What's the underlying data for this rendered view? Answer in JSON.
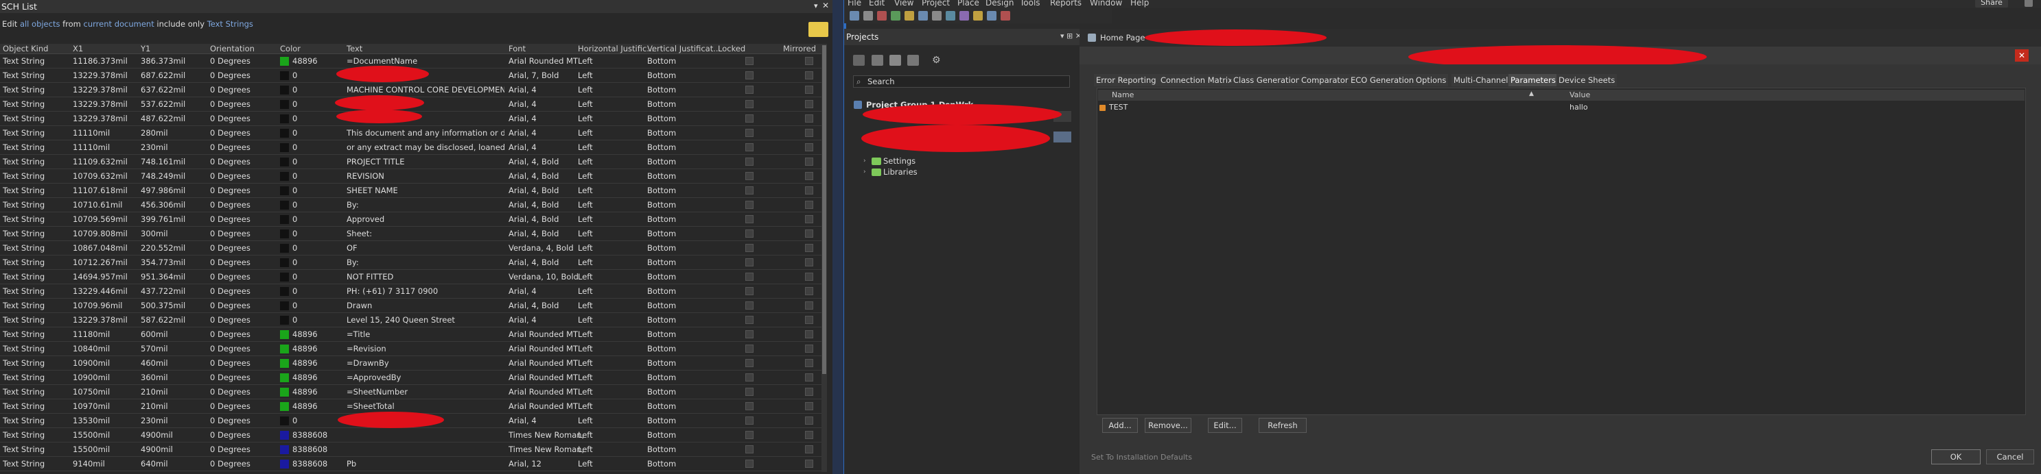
{
  "sch_list": {
    "title": "SCH List",
    "filter": {
      "p1": "Edit ",
      "p2": "all objects",
      "p3": " from ",
      "p4": "current document",
      "p5": " include only ",
      "p6": "Text Strings"
    },
    "columns": [
      "Object Kind",
      "X1",
      "Y1",
      "Orientation",
      "Color",
      "Text",
      "Font",
      "Horizontal Justific...",
      "Vertical Justificat...",
      "Locked",
      "Mirrored"
    ],
    "rows": [
      [
        "Text String",
        "11186.373mil",
        "386.373mil",
        "0 Degrees",
        "48896",
        "=DocumentName",
        "Arial Rounded MT",
        "Left",
        "Bottom",
        "green"
      ],
      [
        "Text String",
        "13229.378mil",
        "687.622mil",
        "0 Degrees",
        "0",
        "",
        "Arial, 7, Bold",
        "Left",
        "Bottom",
        "black"
      ],
      [
        "Text String",
        "13229.378mil",
        "637.622mil",
        "0 Degrees",
        "0",
        "MACHINE CONTROL CORE DEVELOPMENT",
        "Arial, 4",
        "Left",
        "Bottom",
        "black"
      ],
      [
        "Text String",
        "13229.378mil",
        "537.622mil",
        "0 Degrees",
        "0",
        "",
        "Arial, 4",
        "Left",
        "Bottom",
        "black"
      ],
      [
        "Text String",
        "13229.378mil",
        "487.622mil",
        "0 Degrees",
        "0",
        "",
        "Arial, 4",
        "Left",
        "Bottom",
        "black"
      ],
      [
        "Text String",
        "11110mil",
        "280mil",
        "0 Degrees",
        "0",
        "This document and any information or descri",
        "Arial, 4",
        "Left",
        "Bottom",
        "black"
      ],
      [
        "Text String",
        "11110mil",
        "230mil",
        "0 Degrees",
        "0",
        "or any extract may be disclosed,  loaned, usec",
        "Arial, 4",
        "Left",
        "Bottom",
        "black"
      ],
      [
        "Text String",
        "11109.632mil",
        "748.161mil",
        "0 Degrees",
        "0",
        "PROJECT TITLE",
        "Arial, 4, Bold",
        "Left",
        "Bottom",
        "black"
      ],
      [
        "Text String",
        "10709.632mil",
        "748.249mil",
        "0 Degrees",
        "0",
        "REVISION",
        "Arial, 4, Bold",
        "Left",
        "Bottom",
        "black"
      ],
      [
        "Text String",
        "11107.618mil",
        "497.986mil",
        "0 Degrees",
        "0",
        "SHEET NAME",
        "Arial, 4, Bold",
        "Left",
        "Bottom",
        "black"
      ],
      [
        "Text String",
        "10710.61mil",
        "456.306mil",
        "0 Degrees",
        "0",
        "By:",
        "Arial, 4, Bold",
        "Left",
        "Bottom",
        "black"
      ],
      [
        "Text String",
        "10709.569mil",
        "399.761mil",
        "0 Degrees",
        "0",
        "Approved",
        "Arial, 4, Bold",
        "Left",
        "Bottom",
        "black"
      ],
      [
        "Text String",
        "10709.808mil",
        "300mil",
        "0 Degrees",
        "0",
        "Sheet:",
        "Arial, 4, Bold",
        "Left",
        "Bottom",
        "black"
      ],
      [
        "Text String",
        "10867.048mil",
        "220.552mil",
        "0 Degrees",
        "0",
        "OF",
        "Verdana, 4, Bold",
        "Left",
        "Bottom",
        "black"
      ],
      [
        "Text String",
        "10712.267mil",
        "354.773mil",
        "0 Degrees",
        "0",
        "By:",
        "Arial, 4, Bold",
        "Left",
        "Bottom",
        "black"
      ],
      [
        "Text String",
        "14694.957mil",
        "951.364mil",
        "0 Degrees",
        "0",
        "NOT FITTED",
        "Verdana, 10, Bold",
        "Left",
        "Bottom",
        "black"
      ],
      [
        "Text String",
        "13229.446mil",
        "437.722mil",
        "0 Degrees",
        "0",
        "PH: (+61) 7 3117 0900",
        "Arial, 4",
        "Left",
        "Bottom",
        "black"
      ],
      [
        "Text String",
        "10709.96mil",
        "500.375mil",
        "0 Degrees",
        "0",
        "Drawn",
        "Arial, 4, Bold",
        "Left",
        "Bottom",
        "black"
      ],
      [
        "Text String",
        "13229.378mil",
        "587.622mil",
        "0 Degrees",
        "0",
        "Level 15, 240 Queen Street",
        "Arial, 4",
        "Left",
        "Bottom",
        "black"
      ],
      [
        "Text String",
        "11180mil",
        "600mil",
        "0 Degrees",
        "48896",
        "=Title",
        "Arial Rounded MT",
        "Left",
        "Bottom",
        "green"
      ],
      [
        "Text String",
        "10840mil",
        "570mil",
        "0 Degrees",
        "48896",
        "=Revision",
        "Arial Rounded MT",
        "Left",
        "Bottom",
        "green"
      ],
      [
        "Text String",
        "10900mil",
        "460mil",
        "0 Degrees",
        "48896",
        "=DrawnBy",
        "Arial Rounded MT",
        "Left",
        "Bottom",
        "green"
      ],
      [
        "Text String",
        "10900mil",
        "360mil",
        "0 Degrees",
        "48896",
        "=ApprovedBy",
        "Arial Rounded MT",
        "Left",
        "Bottom",
        "green"
      ],
      [
        "Text String",
        "10750mil",
        "210mil",
        "0 Degrees",
        "48896",
        "=SheetNumber",
        "Arial Rounded MT",
        "Left",
        "Bottom",
        "green"
      ],
      [
        "Text String",
        "10970mil",
        "210mil",
        "0 Degrees",
        "48896",
        "=SheetTotal",
        "Arial Rounded MT",
        "Left",
        "Bottom",
        "green"
      ],
      [
        "Text String",
        "13530mil",
        "230mil",
        "0 Degrees",
        "0",
        "",
        "Arial, 4",
        "Left",
        "Bottom",
        "black"
      ],
      [
        "Text String",
        "15500mil",
        "4900mil",
        "0 Degrees",
        "8388608",
        "",
        "Times New Roman,",
        "Left",
        "Bottom",
        "navy"
      ],
      [
        "Text String",
        "15500mil",
        "4900mil",
        "0 Degrees",
        "8388608",
        "",
        "Times New Roman,",
        "Left",
        "Bottom",
        "navy"
      ],
      [
        "Text String",
        "9140mil",
        "640mil",
        "0 Degrees",
        "8388608",
        "Pb",
        "Arial, 12",
        "Left",
        "Bottom",
        "navy"
      ]
    ]
  },
  "colors": {
    "green": "#1aa51a",
    "black": "#111111",
    "navy": "#1a1aa0",
    "accent": "#2f6cc0",
    "redaction": "#e0101a"
  },
  "menu": [
    "File",
    "Edit",
    "View",
    "Project",
    "Place",
    "Design",
    "Tools",
    "Reports",
    "Window",
    "Help"
  ],
  "share_label": "Share",
  "projects": {
    "title": "Projects",
    "search_placeholder": "Search",
    "project_group": "Project Group 1.DsnWrk",
    "folders": [
      "Settings",
      "Libraries"
    ]
  },
  "home_tab": "Home Page",
  "dialog": {
    "tabs": [
      "Error Reporting",
      "Connection Matrix",
      "Class Generation",
      "Comparator",
      "ECO Generation",
      "Options",
      "Multi-Channel",
      "Parameters",
      "Device Sheets"
    ],
    "active_tab": "Parameters",
    "columns": [
      "Name",
      "Value"
    ],
    "param": {
      "name": "TEST",
      "value": "hallo"
    },
    "buttons": {
      "add": "Add...",
      "remove": "Remove...",
      "edit": "Edit...",
      "refresh": "Refresh"
    },
    "status": "Set To Installation Defaults",
    "ok": "OK",
    "cancel": "Cancel"
  }
}
